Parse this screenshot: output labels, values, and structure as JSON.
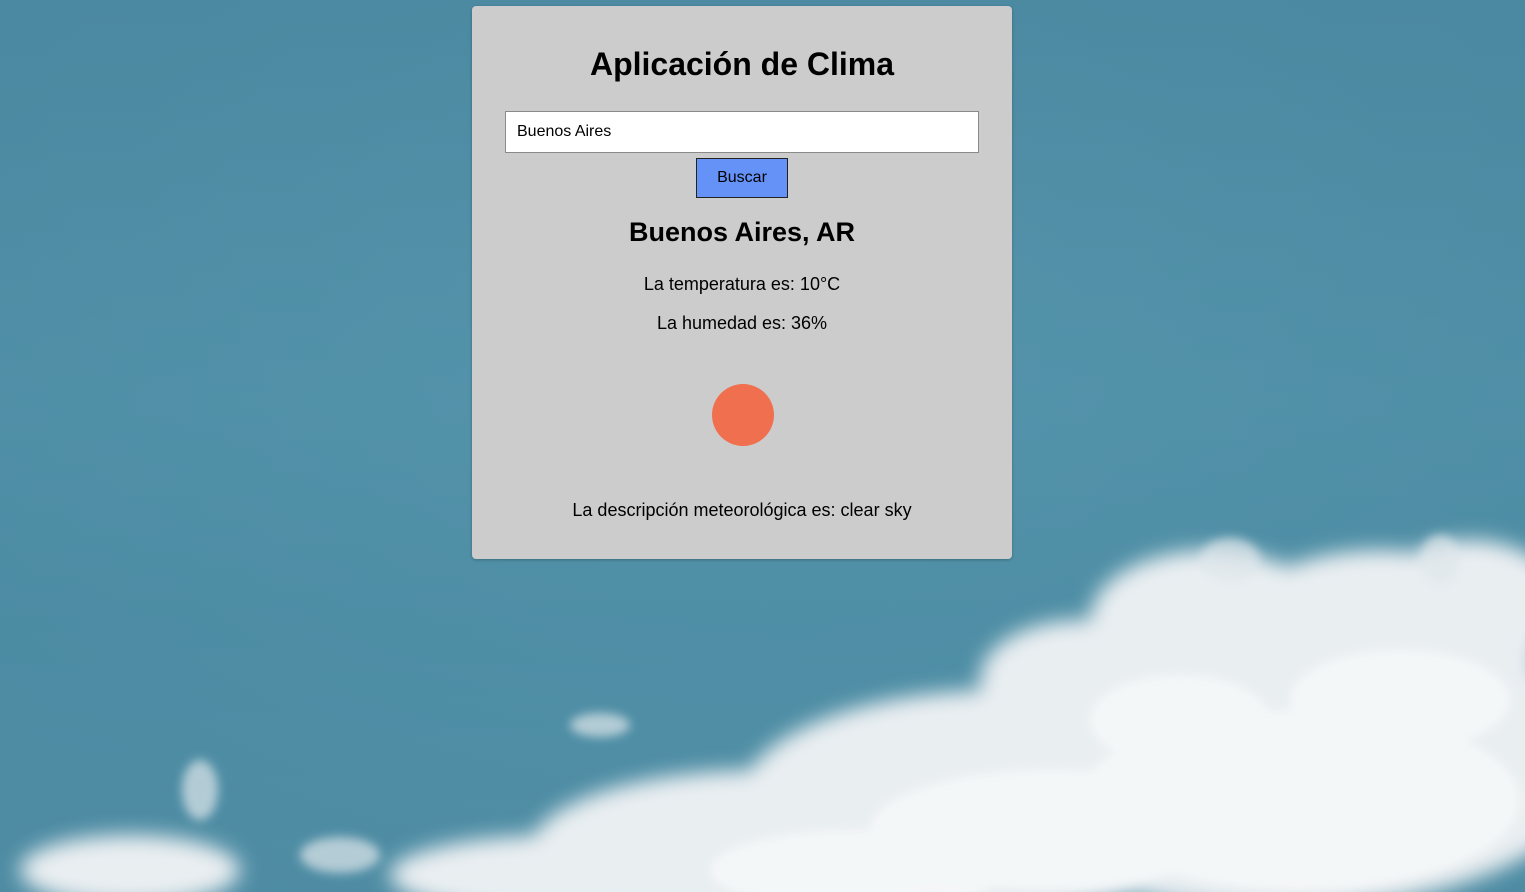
{
  "app": {
    "title": "Aplicación de Clima"
  },
  "search": {
    "value": "Buenos Aires",
    "button_label": "Buscar"
  },
  "weather": {
    "location": "Buenos Aires, AR",
    "temperature_text": "La temperatura es: 10°C",
    "humidity_text": "La humedad es: 36%",
    "description_text": "La descripción meteorológica es: clear sky",
    "icon": "sun-icon"
  },
  "colors": {
    "card_background": "#cccccc",
    "button_background": "#6592f7",
    "sun": "#ef6f4f",
    "sky": "#4f8ea5"
  }
}
